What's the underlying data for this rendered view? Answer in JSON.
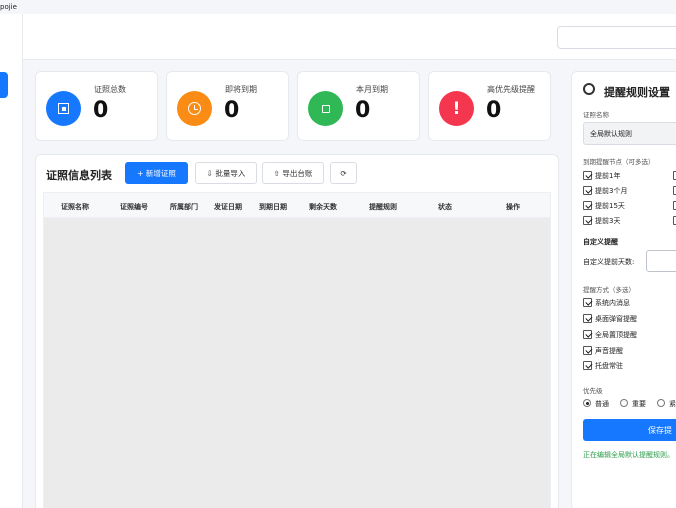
{
  "app": {
    "title": "pojie"
  },
  "stats": [
    {
      "label": "证照总数",
      "value": "0",
      "color": "#1677ff",
      "icon": "square-target-icon"
    },
    {
      "label": "即将到期",
      "value": "0",
      "color": "#fa8c16",
      "icon": "clock-icon"
    },
    {
      "label": "本月到期",
      "value": "0",
      "color": "#2fb855",
      "icon": "calendar-square-icon"
    },
    {
      "label": "高优先级提醒",
      "value": "0",
      "color": "#f5364f",
      "icon": "exclamation-icon"
    }
  ],
  "table": {
    "title": "证照信息列表",
    "buttons": {
      "add": "+ 新增证照",
      "import": "⇩ 批量导入",
      "export": "⇧ 导出台账",
      "refresh": "⟳"
    },
    "columns": [
      "证照名称",
      "证照编号",
      "所属部门",
      "发证日期",
      "到期日期",
      "剩余天数",
      "提醒规则",
      "状态",
      "操作"
    ],
    "rows": []
  },
  "rule_panel": {
    "title": "提醒规则设置",
    "cert_name_label": "证照名称",
    "cert_name_value": "全局默认规则",
    "nodes_label": "到期提醒节点（可多选）",
    "nodes": [
      "提前1年",
      "提前3个月",
      "提前15天",
      "提前3天"
    ],
    "custom_title": "自定义提醒",
    "custom_label": "自定义提前天数:",
    "methods_label": "提醒方式（多选）",
    "methods": [
      "系统内消息",
      "桌面弹窗提醒",
      "全局置顶提醒",
      "声音提醒",
      "托盘常驻"
    ],
    "priority_label": "优先级",
    "priorities": [
      "普通",
      "重要",
      "紧"
    ],
    "selected_priority": "普通",
    "save_label": "保存提",
    "status": "正在编辑全局默认提醒规则。"
  }
}
